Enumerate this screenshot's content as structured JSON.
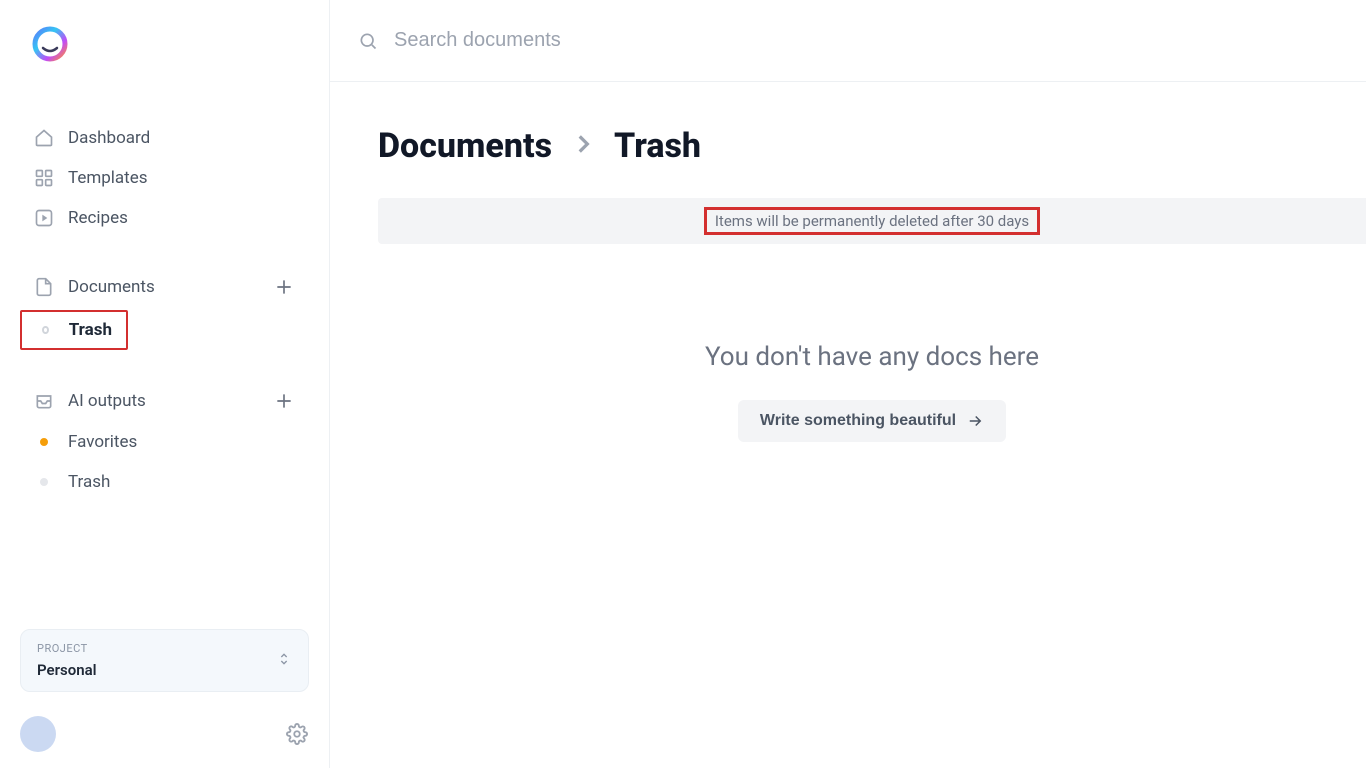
{
  "search": {
    "placeholder": "Search documents"
  },
  "sidebar": {
    "primary": [
      {
        "label": "Dashboard"
      },
      {
        "label": "Templates"
      },
      {
        "label": "Recipes"
      }
    ],
    "documents": {
      "label": "Documents",
      "trash_label": "Trash"
    },
    "outputs": {
      "label": "AI outputs",
      "favorites_label": "Favorites",
      "trash_label": "Trash"
    },
    "project": {
      "caption": "PROJECT",
      "name": "Personal"
    }
  },
  "breadcrumb": {
    "root": "Documents",
    "current": "Trash"
  },
  "notice": "Items will be permanently deleted after 30 days",
  "empty": {
    "headline": "You don't have any docs here",
    "cta": "Write something beautiful"
  }
}
